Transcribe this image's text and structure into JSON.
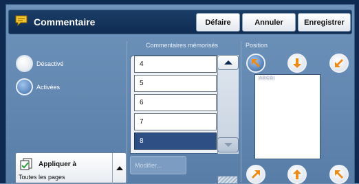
{
  "header": {
    "title": "Commentaire",
    "buttons": {
      "undo": "Défaire",
      "cancel": "Annuler",
      "save": "Enregistrer"
    }
  },
  "mode": {
    "options": [
      {
        "label": "Désactivé",
        "selected": false
      },
      {
        "label": "Activées",
        "selected": true
      }
    ]
  },
  "comments": {
    "heading": "Commentaires mémorisés",
    "items": [
      "4",
      "5",
      "6",
      "7",
      "8"
    ],
    "selected_index": 4
  },
  "apply": {
    "title": "Appliquer à",
    "value": "Toutes les pages"
  },
  "modify_label": "Modifier...",
  "position": {
    "heading": "Position",
    "preview_label": "ABCD",
    "selected": "top-left"
  },
  "colors": {
    "accent_orange": "#f08a10",
    "selected_row": "#2e4f83",
    "header_bg": "#1a3d66"
  }
}
